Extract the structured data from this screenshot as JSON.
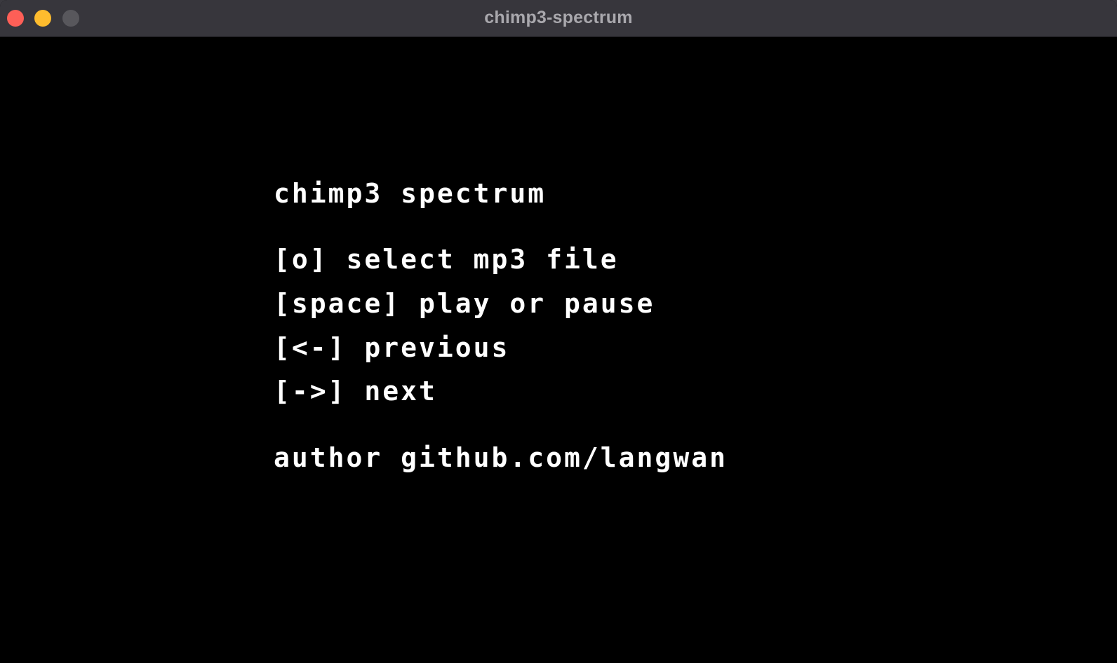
{
  "window": {
    "title": "chimp3-spectrum"
  },
  "screen": {
    "app_title": "chimp3 spectrum",
    "controls": [
      "[o] select mp3 file",
      "[space] play or pause",
      "[<-] previous",
      "[->] next"
    ],
    "author": "author github.com/langwan"
  },
  "colors": {
    "background": "#000000",
    "text": "#ffffff",
    "titlebar": "#37363c",
    "close": "#fe5f57",
    "minimize": "#febc2e",
    "zoom": "#58575c"
  }
}
